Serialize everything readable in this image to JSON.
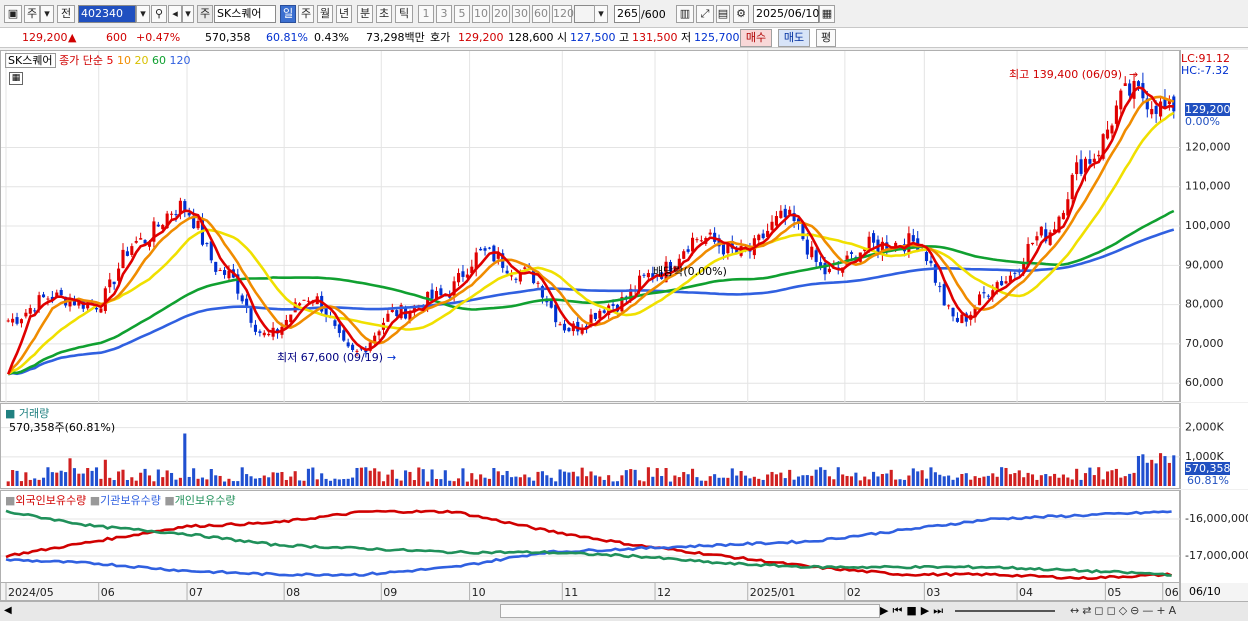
{
  "toolbar": {
    "market": "주",
    "prev": "전",
    "code": "402340",
    "type_badge": "주",
    "name": "SK스퀘어",
    "periods": [
      "일",
      "주",
      "월",
      "년",
      "분",
      "초",
      "틱"
    ],
    "intervals": [
      "1",
      "3",
      "5",
      "10",
      "20",
      "30",
      "60",
      "120"
    ],
    "count": "265",
    "count_total": "/600",
    "date": "2025/06/10"
  },
  "quote": {
    "price": "129,200",
    "arrow": "▲",
    "change": "600",
    "change_pct": "+0.47%",
    "volume": "570,358",
    "vol_ratio": "60.81%",
    "turnover": "0.43%",
    "amount": "73,298백만",
    "bid_label": "호가",
    "bid": "129,200",
    "ask": "128,600",
    "open_label": "시",
    "open": "127,500",
    "high_label": "고",
    "high": "131,500",
    "low_label": "저",
    "low": "125,700",
    "buy": "매수",
    "sell": "매도",
    "eval": "평"
  },
  "price_panel": {
    "name": "SK스퀘어",
    "legend_prefix": "종가 단순",
    "ma_legend": [
      {
        "period": "5",
        "color": "#e00000"
      },
      {
        "period": "10",
        "color": "#f08c00"
      },
      {
        "period": "20",
        "color": "#f0d800"
      },
      {
        "period": "60",
        "color": "#10a030"
      },
      {
        "period": "120",
        "color": "#3060e0"
      }
    ],
    "lc": "LC:91.12",
    "hc": "HC:-7.32",
    "current": "129,200",
    "current_pct": "0.00%",
    "high_note": "최고 139,400 (06/09)",
    "low_note": "최저 67,600 (09/19)",
    "dividend_note": "배당락(0.00%)"
  },
  "volume_panel": {
    "title": "거래량",
    "value": "570,358주(60.81%)",
    "current": "570,358",
    "current_pct": "60.81%"
  },
  "investor_panel": {
    "legend": [
      {
        "label": "외국인보유수량",
        "color": "#d00000"
      },
      {
        "label": "기관보유수량",
        "color": "#3060e0"
      },
      {
        "label": "개인보유수량",
        "color": "#20905a"
      }
    ]
  },
  "x_axis": {
    "labels": [
      "2024/05",
      "06",
      "07",
      "08",
      "09",
      "10",
      "11",
      "12",
      "2025/01",
      "02",
      "03",
      "04",
      "05",
      "06"
    ],
    "end_label": "06/10"
  },
  "chart_data": [
    {
      "type": "candlestick",
      "title": "SK스퀘어",
      "ylim": [
        57000,
        142000
      ],
      "yticks": [
        60000,
        70000,
        80000,
        90000,
        100000,
        110000,
        120000
      ],
      "ytick_labels": [
        "60,000",
        "70,000",
        "80,000",
        "90,000",
        "100,000",
        "110,000",
        "120,000"
      ],
      "close_anchors": [
        [
          "2024/05",
          76000
        ],
        [
          "06",
          82000
        ],
        [
          "06 mid",
          80000
        ],
        [
          "07",
          96000
        ],
        [
          "07 mid",
          105000
        ],
        [
          "08",
          88000
        ],
        [
          "08 mid",
          72000
        ],
        [
          "09",
          82000
        ],
        [
          "09 late",
          67600
        ],
        [
          "10",
          78000
        ],
        [
          "10 mid",
          82000
        ],
        [
          "11",
          93000
        ],
        [
          "11 mid",
          88000
        ],
        [
          "12",
          74000
        ],
        [
          "12 mid",
          80000
        ],
        [
          "2025/01",
          88000
        ],
        [
          "01 mid",
          97000
        ],
        [
          "02",
          93000
        ],
        [
          "02 mid",
          102000
        ],
        [
          "03",
          88000
        ],
        [
          "03 mid",
          95000
        ],
        [
          "04",
          96000
        ],
        [
          "04 low",
          76000
        ],
        [
          "05",
          86000
        ],
        [
          "05 mid",
          98000
        ],
        [
          "06",
          117000
        ],
        [
          "06/09",
          134000
        ],
        [
          "06/10",
          129200
        ]
      ],
      "moving_averages": [
        "5",
        "10",
        "20",
        "60",
        "120"
      ]
    },
    {
      "type": "bar",
      "title": "거래량",
      "yticks": [
        1000,
        2000
      ],
      "ytick_labels": [
        "1,000K",
        "2,000K"
      ],
      "latest": 570358
    },
    {
      "type": "line",
      "yticks": [
        -16000000,
        -17000000
      ],
      "ytick_labels": [
        "-16,000,000",
        "-17,000,000"
      ],
      "series": [
        {
          "name": "외국인보유수량",
          "color": "#d00000"
        },
        {
          "name": "기관보유수량",
          "color": "#3060e0"
        },
        {
          "name": "개인보유수량",
          "color": "#20905a"
        }
      ]
    }
  ]
}
